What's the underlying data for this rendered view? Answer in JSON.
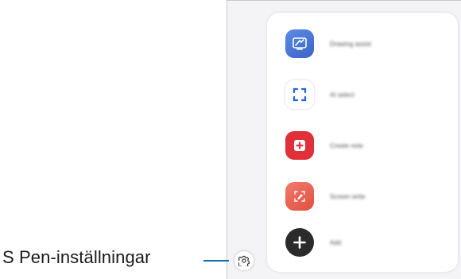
{
  "callout": {
    "label": "S Pen-inställningar"
  },
  "settings_button": {
    "icon": "gear-icon"
  },
  "air_command": {
    "items": [
      {
        "label": "Drawing assist",
        "icon": "drawing-assist-icon"
      },
      {
        "label": "AI select",
        "icon": "ai-select-icon"
      },
      {
        "label": "Create note",
        "icon": "create-note-icon"
      },
      {
        "label": "Screen write",
        "icon": "screen-write-icon"
      },
      {
        "label": "Add",
        "icon": "plus-icon"
      }
    ]
  },
  "colors": {
    "callout_line": "#0e6fa8",
    "create_note": "#e0303a",
    "drawing_assist": "#3a62c7",
    "screen_write": "#e0503f",
    "add": "#2b2b2b"
  }
}
